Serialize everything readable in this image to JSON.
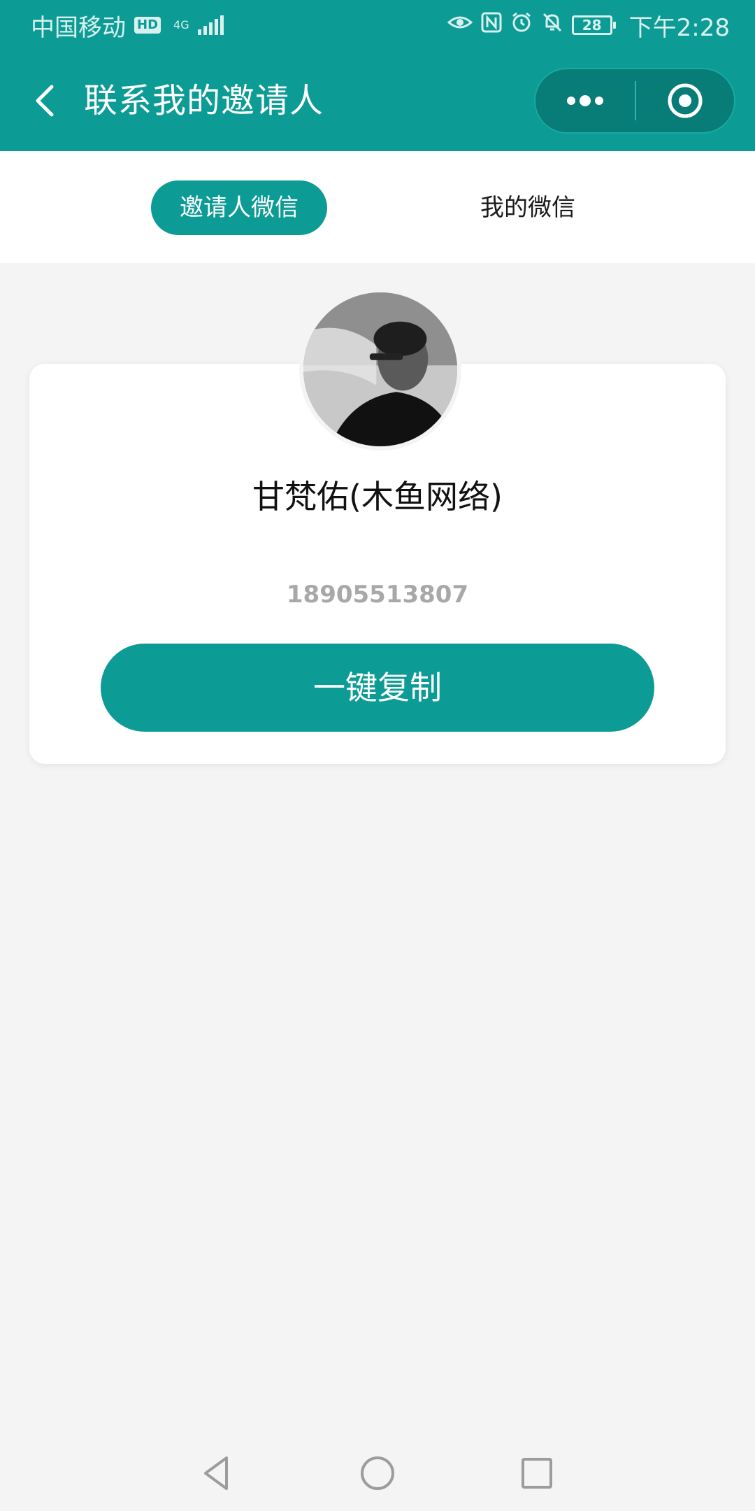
{
  "status_bar": {
    "carrier": "中国移动",
    "hd": "HD",
    "network": "4G",
    "battery": "28",
    "time": "下午2:28"
  },
  "header": {
    "title": "联系我的邀请人",
    "icons": [
      "back-icon",
      "more-icon",
      "close-target-icon"
    ]
  },
  "tabs": [
    {
      "label": "邀请人微信",
      "active": true
    },
    {
      "label": "我的微信",
      "active": false
    }
  ],
  "inviter": {
    "name": "甘梵佑(木鱼网络)",
    "phone": "18905513807",
    "copy_label": "一键复制"
  },
  "nav": {
    "icons": [
      "nav-back-icon",
      "nav-home-icon",
      "nav-recent-icon"
    ]
  },
  "colors": {
    "primary": "#0d9b95",
    "background": "#f4f4f4"
  }
}
